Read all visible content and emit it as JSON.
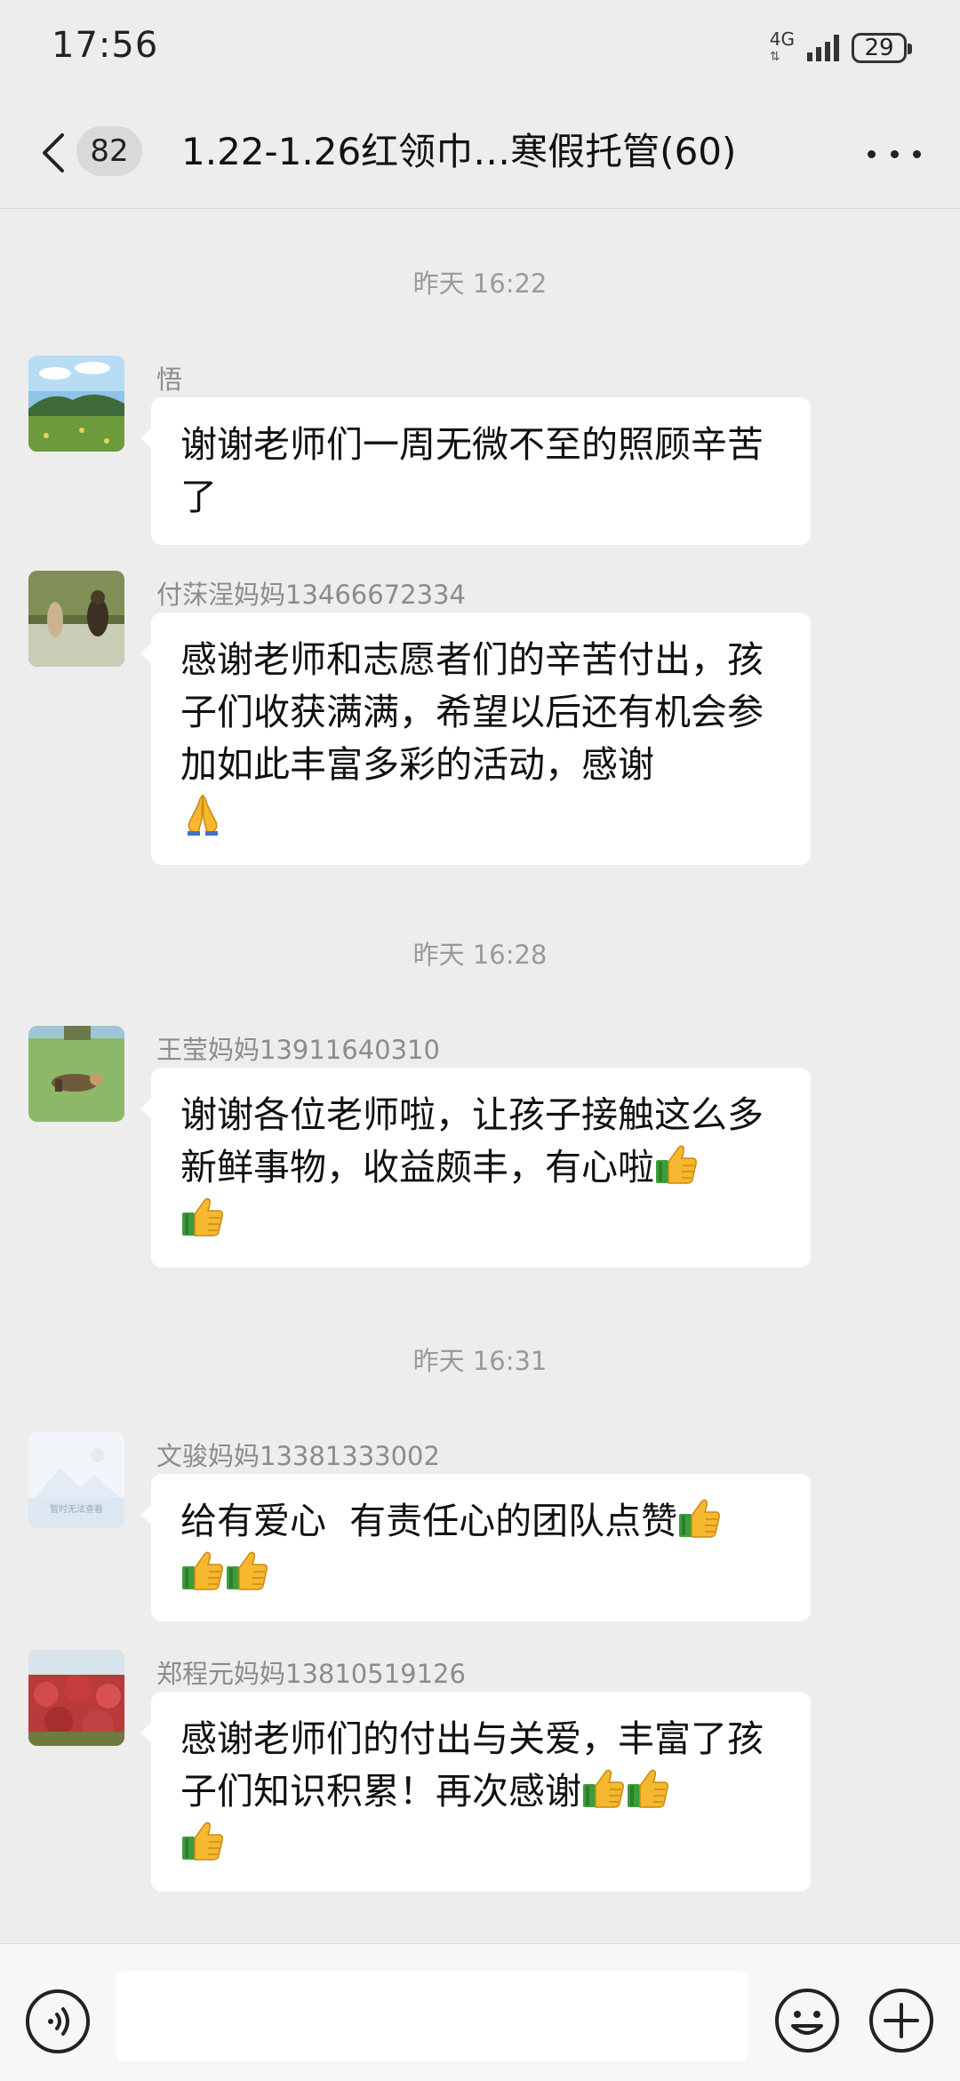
{
  "status_bar": {
    "time": "17:56",
    "network": "4G",
    "battery": "29",
    "icons": [
      "signal-icon",
      "battery-icon"
    ]
  },
  "header": {
    "back_icon": "chevron-left-icon",
    "unread_count": "82",
    "title": "1.22-1.26红领巾…寒假托管(60)",
    "more_icon": "more-dots-icon"
  },
  "timestamps": [
    "昨天 16:22",
    "昨天 16:28",
    "昨天 16:31"
  ],
  "messages": [
    {
      "sender": "悟",
      "text": "谢谢老师们一周无微不至的照顾辛苦了"
    },
    {
      "sender": "付莯浧妈妈13466672334",
      "text": "感谢老师和志愿者们的辛苦付出，孩子们收获满满，希望以后还有机会参加如此丰富多彩的活动，感谢",
      "emoji": [
        "pray"
      ]
    },
    {
      "sender": "王莹妈妈13911640310",
      "text": "谢谢各位老师啦，让孩子接触这么多新鲜事物，收益颇丰，有心啦",
      "emoji": [
        "thumbs-up",
        "thumbs-up"
      ]
    },
    {
      "sender": "文骏妈妈13381333002",
      "text": "给有爱心  有责任心的团队点赞",
      "emoji": [
        "thumbs-up",
        "thumbs-up",
        "thumbs-up"
      ],
      "avatar_text": "暂时无法查看"
    },
    {
      "sender": "郑程元妈妈13810519126",
      "text": "感谢老师们的付出与关爱，丰富了孩子们知识积累！再次感谢",
      "emoji": [
        "thumbs-up",
        "thumbs-up",
        "thumbs-up"
      ]
    }
  ],
  "input_bar": {
    "voice_icon": "voice-icon",
    "emoji_icon": "emoji-face-icon",
    "plus_icon": "plus-icon"
  },
  "colors": {
    "background": "#EDEDED",
    "bubble": "#FFFFFF",
    "timestamp_text": "#9A9A9A",
    "sender_text": "#8C8C8C"
  }
}
